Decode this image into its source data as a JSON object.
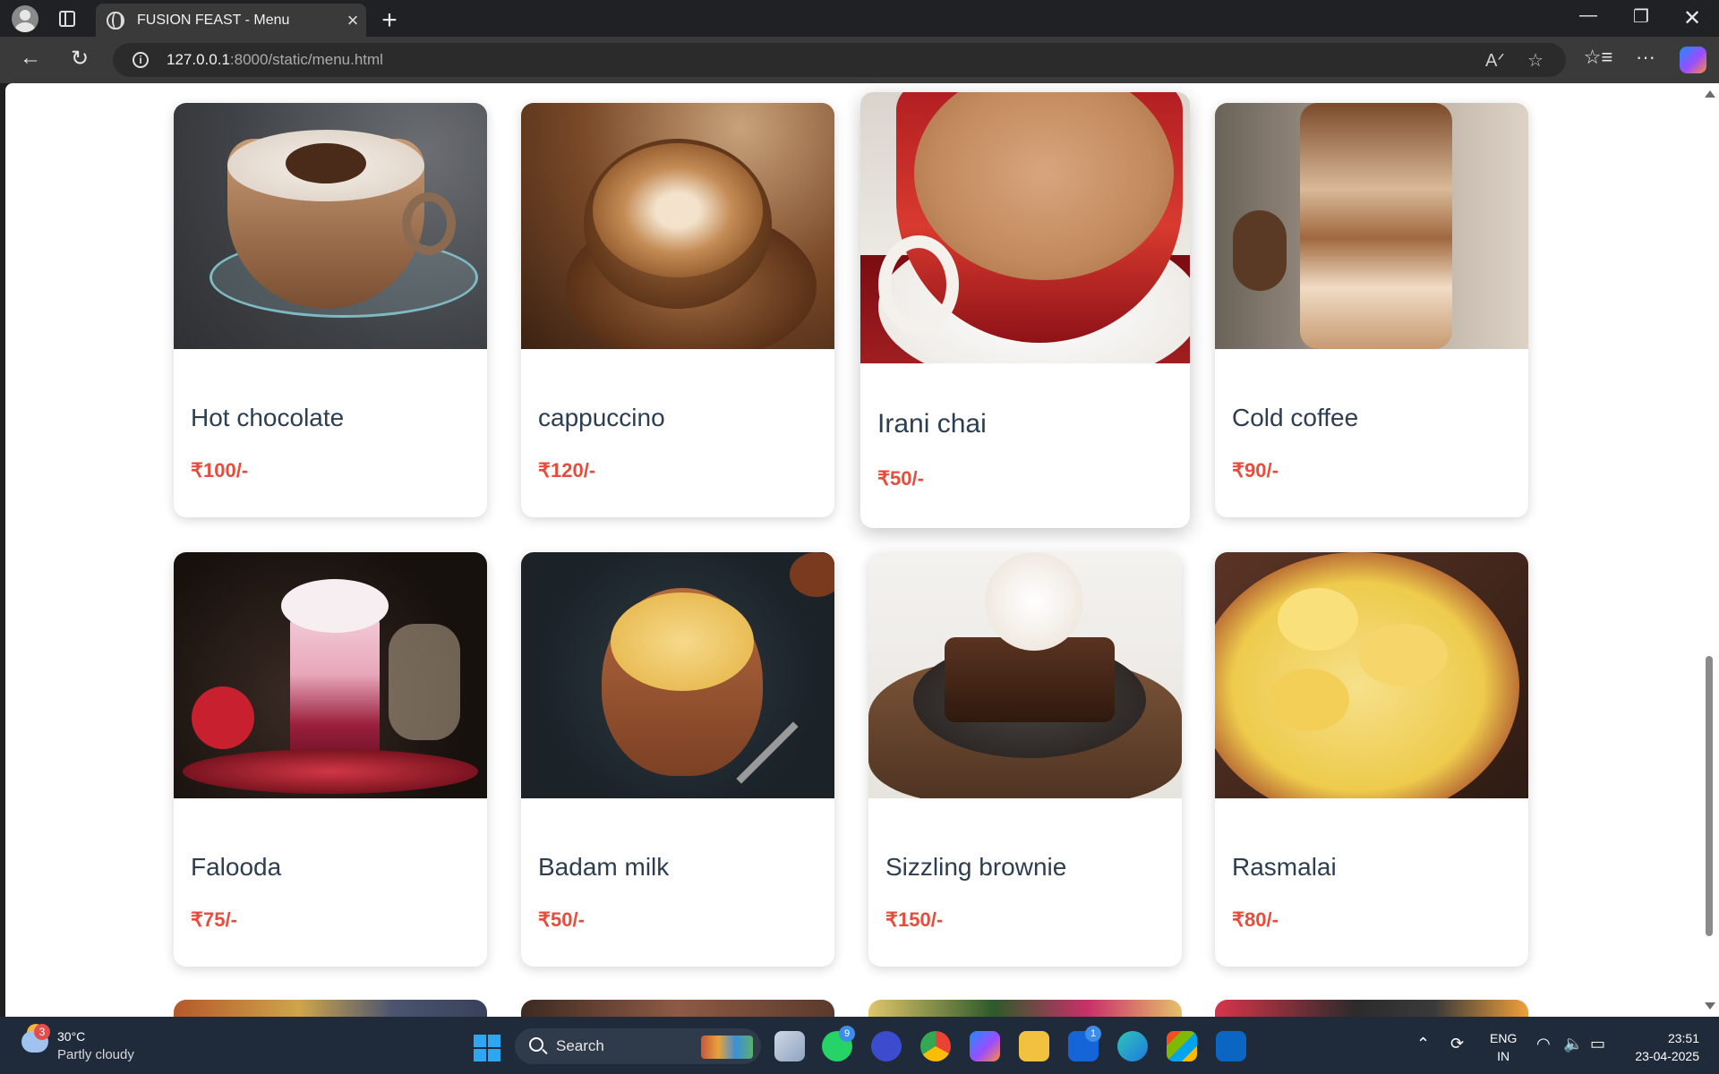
{
  "browser": {
    "tab_title": "FUSION FEAST - Menu",
    "url_host": "127.0.0.1",
    "url_rest": ":8000/static/menu.html"
  },
  "menu": {
    "items": [
      {
        "name": "Hot chocolate",
        "price": "₹100/-",
        "image": "hot-chocolate-image"
      },
      {
        "name": "cappuccino",
        "price": "₹120/-",
        "image": "cappuccino-image"
      },
      {
        "name": "Irani chai",
        "price": "₹50/-",
        "image": "irani-chai-image"
      },
      {
        "name": "Cold coffee",
        "price": "₹90/-",
        "image": "cold-coffee-image"
      },
      {
        "name": "Falooda",
        "price": "₹75/-",
        "image": "falooda-image"
      },
      {
        "name": "Badam milk",
        "price": "₹50/-",
        "image": "badam-milk-image"
      },
      {
        "name": "Sizzling brownie",
        "price": "₹150/-",
        "image": "sizzling-brownie-image"
      },
      {
        "name": "Rasmalai",
        "price": "₹80/-",
        "image": "rasmalai-image"
      }
    ]
  },
  "colors": {
    "item_name": "#2c3e50",
    "price": "#e74c3c"
  },
  "taskbar": {
    "weather_badge": "3",
    "temperature": "30°C",
    "condition": "Partly cloudy",
    "search_label": "Search",
    "whatsapp_badge": "9",
    "l_app_badge": "1",
    "lang_line1": "ENG",
    "lang_line2": "IN",
    "time": "23:51",
    "date": "23-04-2025"
  }
}
